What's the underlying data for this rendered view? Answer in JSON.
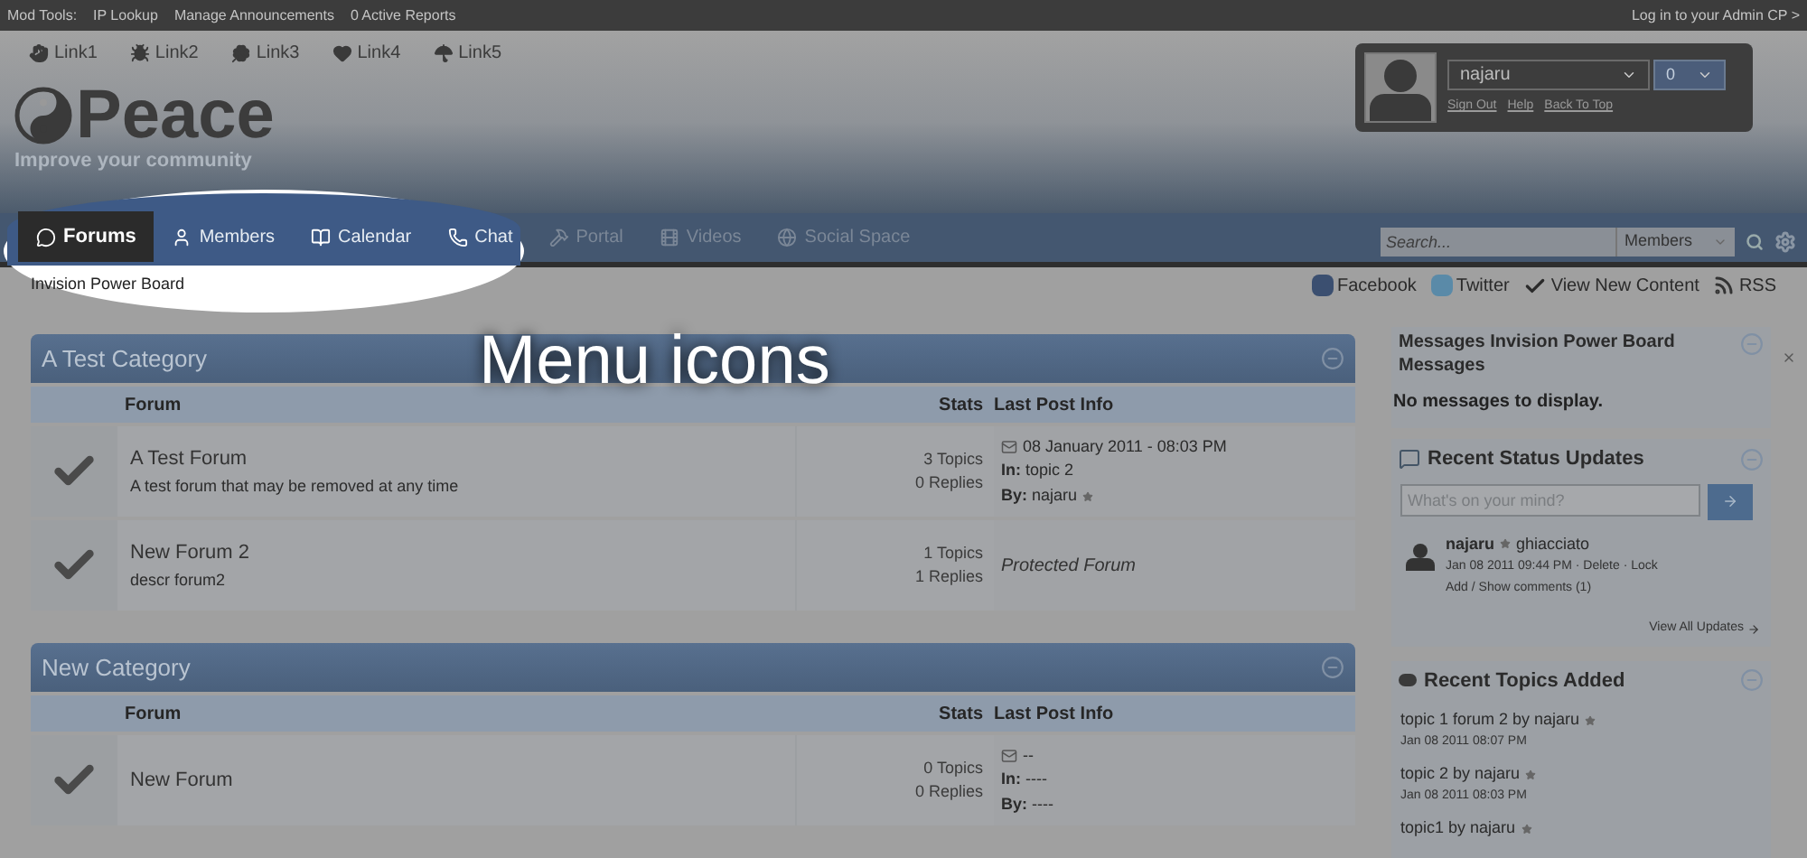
{
  "mod_bar": {
    "label": "Mod Tools:",
    "links": [
      "IP Lookup",
      "Manage Announcements",
      "0 Active Reports"
    ],
    "admin_link": "Log in to your Admin CP >"
  },
  "header_links": [
    {
      "label": "Link1",
      "kind": "hand"
    },
    {
      "label": "Link2",
      "kind": "bug"
    },
    {
      "label": "Link3",
      "kind": "clover"
    },
    {
      "label": "Link4",
      "kind": "heart"
    },
    {
      "label": "Link5",
      "kind": "umbrella"
    }
  ],
  "logo": {
    "name": "Peace",
    "tagline": "Improve your community"
  },
  "user_box": {
    "username": "najaru",
    "notifications": "0",
    "links": [
      "Sign Out",
      "Help",
      "Back To Top"
    ]
  },
  "nav": {
    "items": [
      {
        "label": "Forums",
        "kind": "chat",
        "selected": true,
        "highlighted": true
      },
      {
        "label": "Members",
        "kind": "user",
        "selected": false,
        "highlighted": true
      },
      {
        "label": "Calendar",
        "kind": "calendar",
        "selected": false,
        "highlighted": true
      },
      {
        "label": "Chat",
        "kind": "phone",
        "selected": false,
        "highlighted": true
      },
      {
        "label": "Portal",
        "kind": "hammer",
        "selected": false,
        "highlighted": false
      },
      {
        "label": "Videos",
        "kind": "film",
        "selected": false,
        "highlighted": false
      },
      {
        "label": "Social Space",
        "kind": "globe",
        "selected": false,
        "highlighted": false
      }
    ],
    "search": {
      "placeholder": "Search...",
      "scope": "Members"
    }
  },
  "annotation": "Menu icons",
  "breadcrumb": "Invision Power Board",
  "share_links": [
    {
      "label": "Facebook",
      "kind": "facebook"
    },
    {
      "label": "Twitter",
      "kind": "twitter"
    },
    {
      "label": "View New Content",
      "kind": "check"
    },
    {
      "label": "RSS",
      "kind": "rss"
    }
  ],
  "categories": [
    {
      "title": "A Test Category",
      "columns": [
        "Forum",
        "Stats",
        "Last Post Info"
      ],
      "forums": [
        {
          "name": "A Test Forum",
          "description": "A test forum that may be removed at any time",
          "topics": "3 Topics",
          "replies": "0 Replies",
          "last_post": {
            "kind": "post",
            "date": "08 January 2011 - 08:03 PM",
            "in": "**In:** topic 2",
            "by": "**By:** najaru"
          }
        },
        {
          "name": "New Forum 2",
          "description": "descr forum2",
          "topics": "1 Topics",
          "replies": "1 Replies",
          "last_post": {
            "kind": "protected",
            "text": "Protected Forum"
          }
        }
      ]
    },
    {
      "title": "New Category",
      "columns": [
        "Forum",
        "Stats",
        "Last Post Info"
      ],
      "forums": [
        {
          "name": "New Forum",
          "topics": "0 Topics",
          "replies": "0 Replies",
          "last_post": {
            "kind": "post",
            "date": "--",
            "in": "**In:** ----",
            "by": "**By:** ----"
          }
        }
      ]
    }
  ],
  "sidebar": {
    "messages": {
      "title": "Messages Invision Power Board Messages",
      "empty": "No messages to display."
    },
    "status": {
      "title": "Recent Status Updates",
      "placeholder": "What's on your mind?",
      "update": {
        "user": "najaru",
        "text": "ghiacciato",
        "meta": "Jan 08 2011 09:44 PM · Delete · Lock",
        "comments": "Add / Show comments (1)"
      },
      "view_all": "View All Updates"
    },
    "topics": {
      "title": "Recent Topics Added",
      "items": [
        {
          "title": "topic 1 forum 2 by najaru",
          "date": "Jan 08 2011 08:07 PM"
        },
        {
          "title": "topic 2 by najaru",
          "date": "Jan 08 2011 08:03 PM"
        },
        {
          "title": "topic1 by najaru"
        }
      ]
    }
  }
}
